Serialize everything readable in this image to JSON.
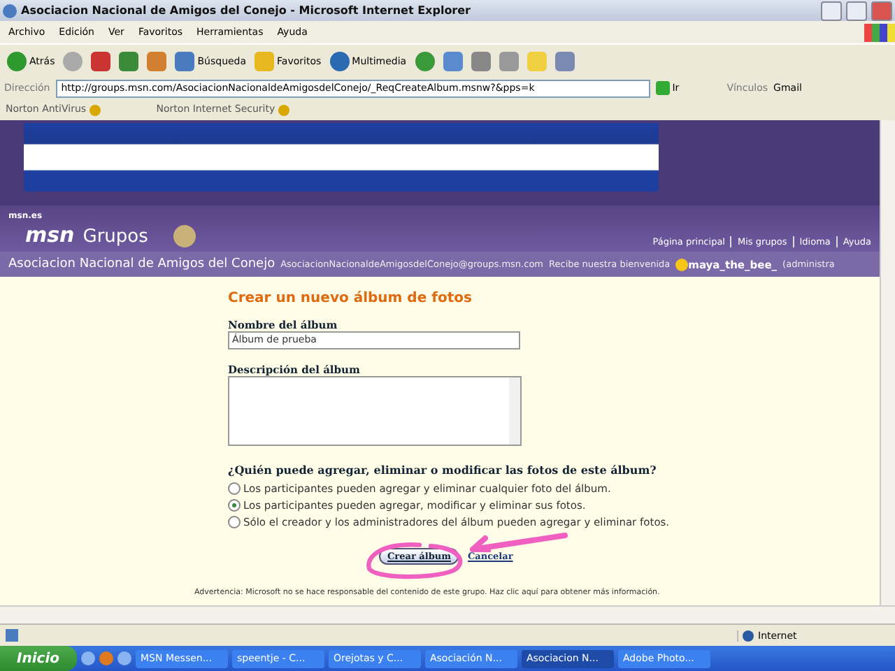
{
  "window": {
    "title": "Asociacion Nacional de Amigos del Conejo - Microsoft Internet Explorer"
  },
  "menu": [
    "Archivo",
    "Edición",
    "Ver",
    "Favoritos",
    "Herramientas",
    "Ayuda"
  ],
  "toolbar": [
    {
      "kind": "back",
      "label": "Atrás"
    },
    {
      "kind": "forward"
    },
    {
      "kind": "stop"
    },
    {
      "kind": "refresh"
    },
    {
      "kind": "home"
    },
    {
      "kind": "search",
      "label": "Búsqueda"
    },
    {
      "kind": "star",
      "label": "Favoritos"
    },
    {
      "kind": "media",
      "label": "Multimedia"
    },
    {
      "kind": "history"
    },
    {
      "kind": "mail"
    },
    {
      "kind": "print"
    },
    {
      "kind": "edit"
    },
    {
      "kind": "note"
    },
    {
      "kind": "msg"
    }
  ],
  "address": {
    "label": "Dirección",
    "value": "http://groups.msn.com/AsociacionNacionaldeAmigosdelConejo/_ReqCreateAlbum.msnw?&pps=k",
    "go": "Ir",
    "links_label": "Vínculos",
    "link": "Gmail"
  },
  "norton": [
    "Norton AntiVirus",
    "Norton Internet Security"
  ],
  "header": {
    "brand_small": "msn.es",
    "brand": "msn",
    "section": "Grupos",
    "nav": [
      "Página principal",
      "Mis grupos",
      "Idioma",
      "Ayuda"
    ]
  },
  "group_bar": {
    "name": "Asociacion Nacional de Amigos del Conejo",
    "email": "AsociacionNacionaldeAmigosdelConejo@groups.msn.com",
    "welcome": "Recibe nuestra bienvenida",
    "user": "maya_the_bee_",
    "role": "(administra"
  },
  "form": {
    "title": "Crear un nuevo álbum de fotos",
    "name_label": "Nombre del álbum",
    "name_value": "Álbum de prueba",
    "desc_label": "Descripción del álbum",
    "question": "¿Quién puede agregar, eliminar o modificar las fotos de este álbum?",
    "options": [
      {
        "label": "Los participantes pueden agregar y eliminar cualquier foto del álbum.",
        "selected": false
      },
      {
        "label": "Los participantes pueden agregar, modificar y eliminar sus fotos.",
        "selected": true
      },
      {
        "label": "Sólo el creador y los administradores del álbum pueden agregar y eliminar fotos.",
        "selected": false
      }
    ],
    "submit": "Crear álbum",
    "cancel": "Cancelar"
  },
  "warning": "Advertencia: Microsoft no se hace responsable del contenido de este grupo. Haz clic aquí para obtener más información.",
  "status": {
    "zone": "Internet"
  },
  "taskbar": {
    "start": "Inicio",
    "tasks": [
      {
        "label": "MSN Messen...",
        "selected": false
      },
      {
        "label": "speentje - C...",
        "selected": false
      },
      {
        "label": "Orejotas y C...",
        "selected": false
      },
      {
        "label": "Asociación N...",
        "selected": false
      },
      {
        "label": "Asociacion N...",
        "selected": true
      },
      {
        "label": "Adobe Photo...",
        "selected": false
      }
    ]
  }
}
